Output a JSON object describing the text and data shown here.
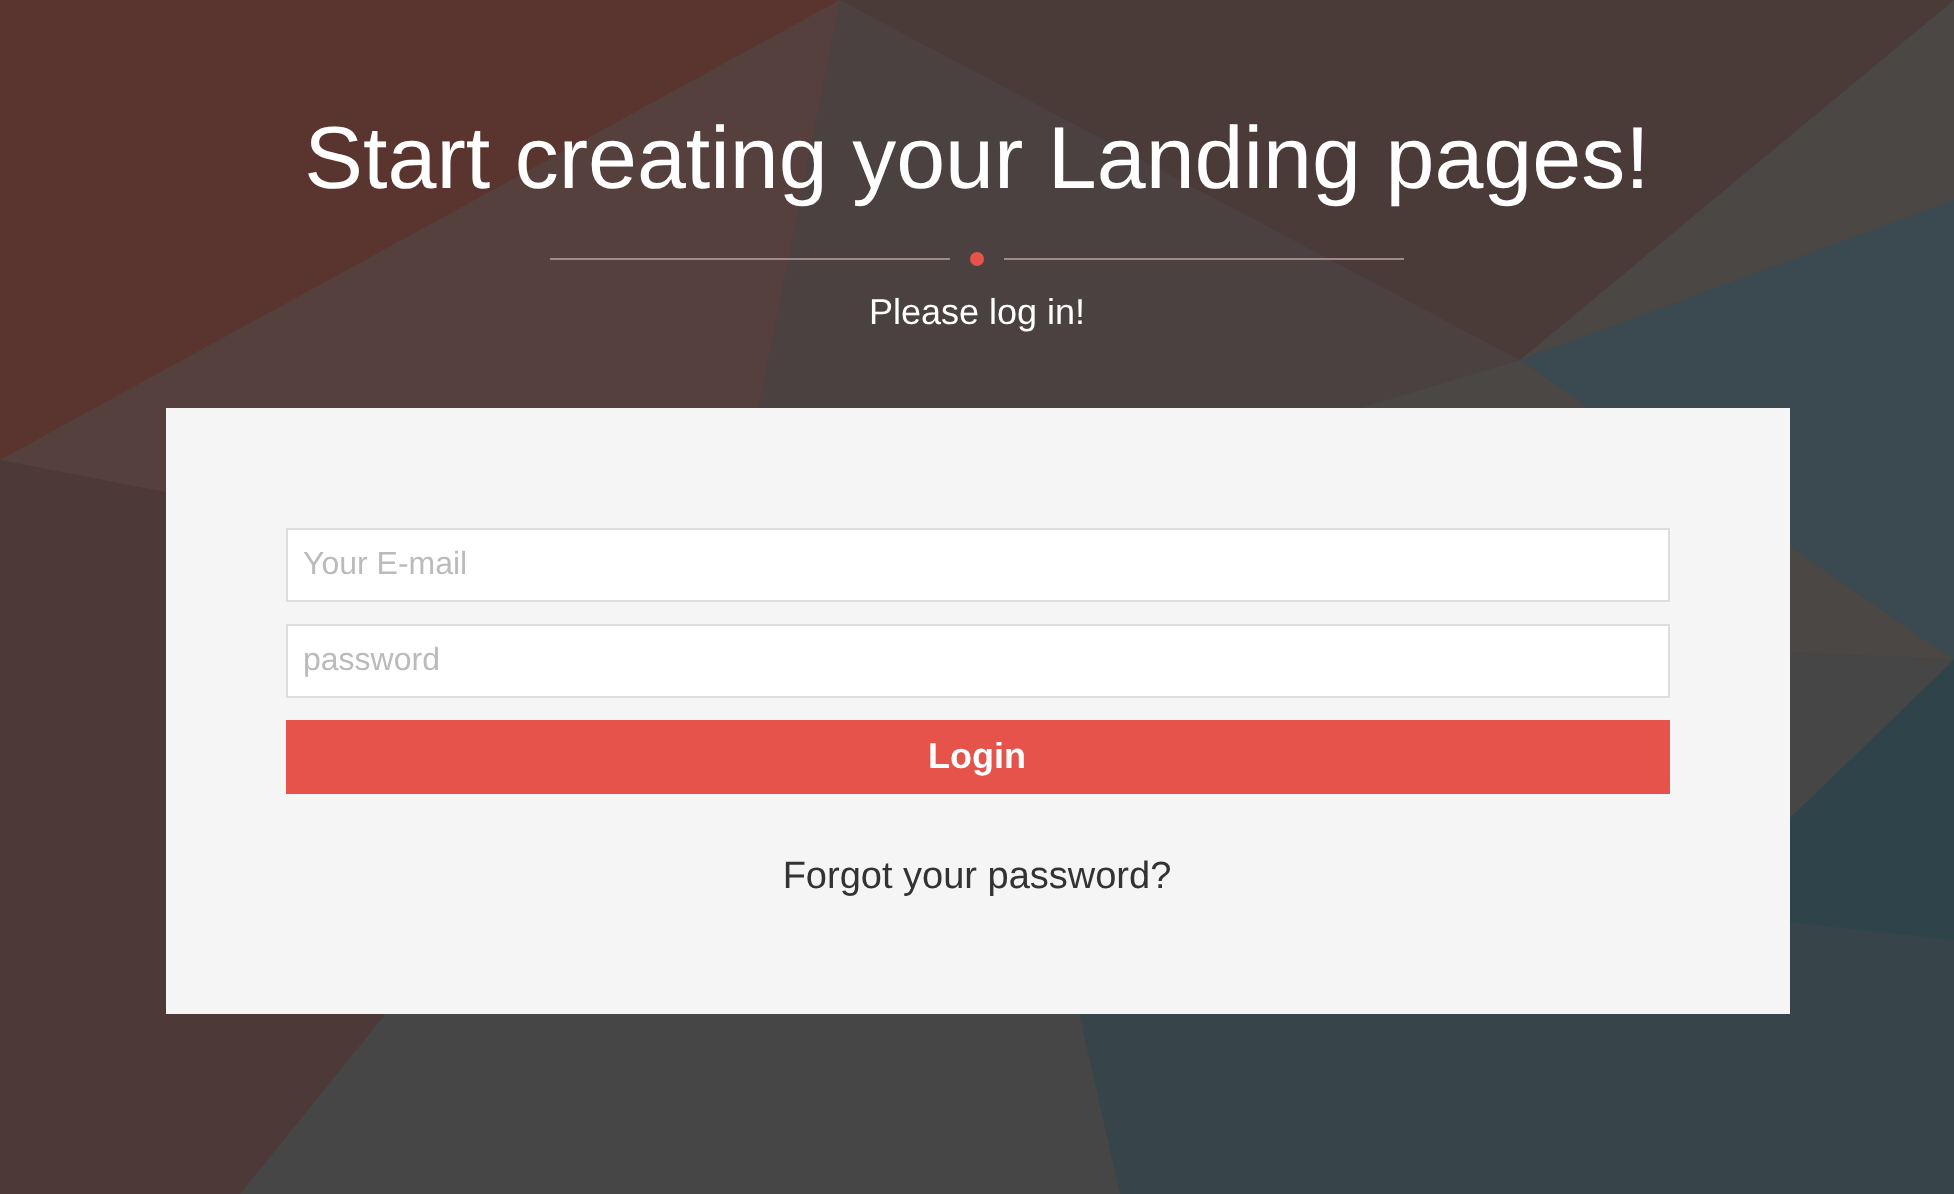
{
  "header": {
    "title": "Start creating your Landing pages!",
    "subtitle": "Please log in!"
  },
  "form": {
    "email": {
      "placeholder": "Your E-mail"
    },
    "password": {
      "placeholder": "password"
    },
    "submit": "Login",
    "forgot_link": "Forgot your password?"
  }
}
